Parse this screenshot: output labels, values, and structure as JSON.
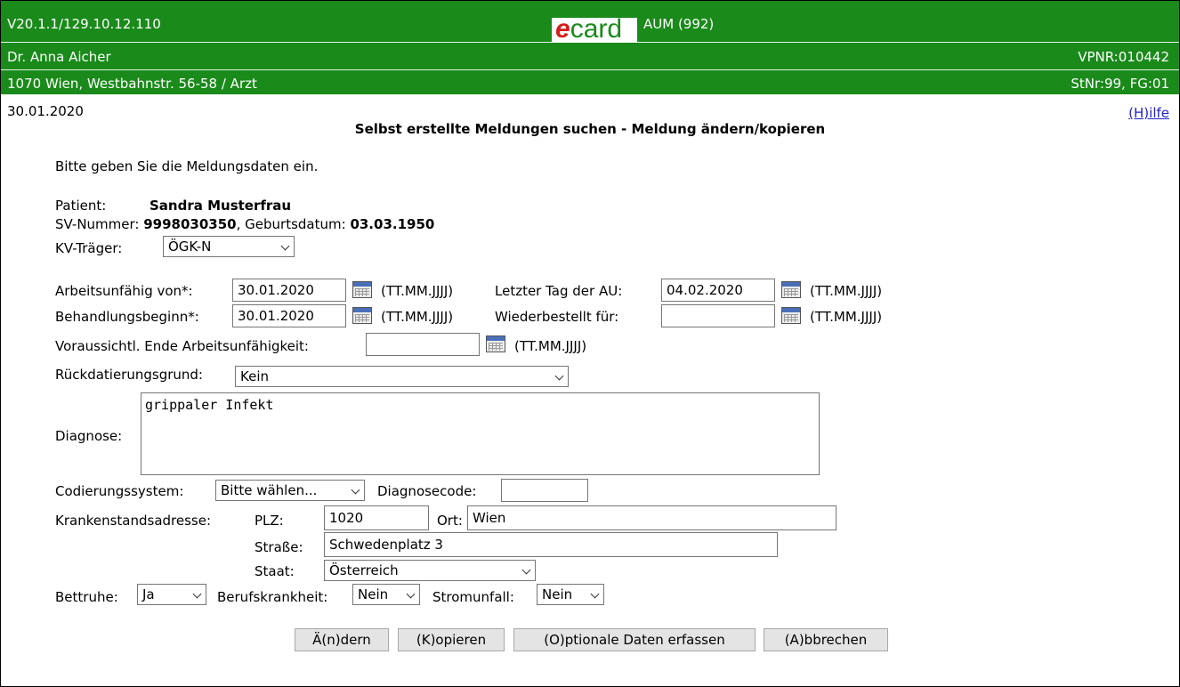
{
  "header": {
    "version": "V20.1.1/129.10.12.110",
    "logo_e": "e",
    "logo_card": "card",
    "app": "AUM (992)",
    "doctor": "Dr. Anna Aicher",
    "vpnr": "VPNR:010442",
    "address": "1070 Wien, Westbahnstr. 56-58 / Arzt",
    "stnr": "StNr:99, FG:01",
    "date": "30.01.2020",
    "help": "(H)ilfe"
  },
  "page_title": "Selbst erstellte Meldungen suchen - Meldung ändern/kopieren",
  "intro": "Bitte geben Sie die Meldungsdaten ein.",
  "patient": {
    "label": "Patient:",
    "name": "Sandra Musterfrau",
    "sv_label": "SV-Nummer:",
    "sv": "9998030350",
    "birth_label": ", Geburtsdatum:",
    "birth": "03.03.1950",
    "kv_label": "KV-Träger:",
    "kv": "ÖGK-N"
  },
  "dates": {
    "format": "(TT.MM.JJJJ)",
    "au_von_label": "Arbeitsunfähig von*:",
    "au_von": "30.01.2020",
    "letzter_label": "Letzter Tag der AU:",
    "letzter": "04.02.2020",
    "beginn_label": "Behandlungsbeginn*:",
    "beginn": "30.01.2020",
    "wieder_label": "Wiederbestellt für:",
    "wieder": "",
    "ende_label": "Voraussichtl. Ende Arbeitsunfähigkeit:",
    "ende": ""
  },
  "rueck": {
    "label": "Rückdatierungsgrund:",
    "value": "Kein"
  },
  "diagnose": {
    "label": "Diagnose:",
    "text": "grippaler Infekt"
  },
  "codierung": {
    "label": "Codierungssystem:",
    "value": "Bitte wählen...",
    "code_label": "Diagnosecode:",
    "code": ""
  },
  "adresse": {
    "label": "Krankenstandsadresse:",
    "plz_label": "PLZ:",
    "plz": "1020",
    "ort_label": "Ort:",
    "ort": "Wien",
    "strasse_label": "Straße:",
    "strasse": "Schwedenplatz 3",
    "staat_label": "Staat:",
    "staat": "Österreich"
  },
  "flags": {
    "bettruhe_label": "Bettruhe:",
    "bettruhe": "Ja",
    "beruf_label": "Berufskrankheit:",
    "beruf": "Nein",
    "strom_label": "Stromunfall:",
    "strom": "Nein"
  },
  "buttons": {
    "aendern": "Ä(n)dern",
    "kopieren": "(K)opieren",
    "optional": "(O)ptionale Daten erfassen",
    "abbrechen": "(A)bbrechen"
  }
}
